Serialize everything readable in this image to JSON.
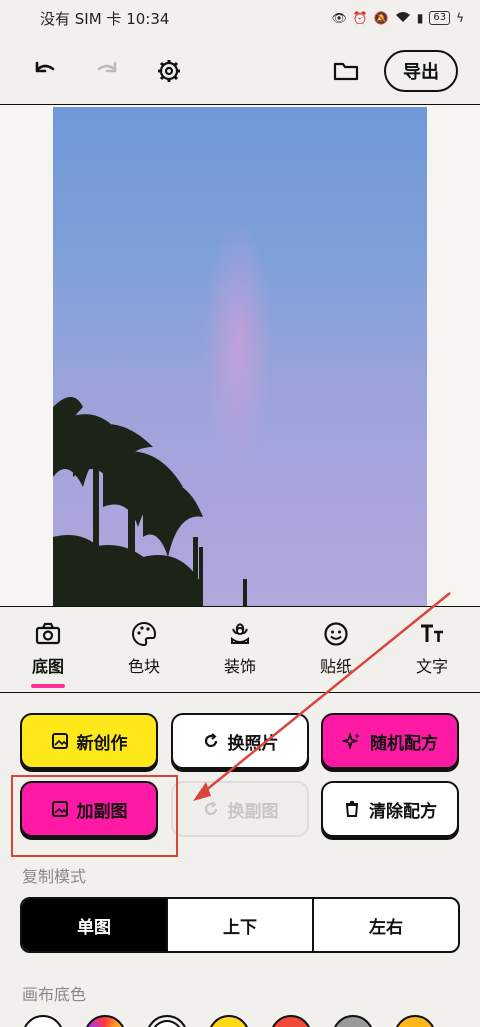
{
  "status_bar": {
    "carrier": "没有 SIM 卡",
    "time": "10:34",
    "battery": "63"
  },
  "toolbar": {
    "export_label": "导出"
  },
  "tabs": [
    {
      "label": "底图",
      "icon": "camera-icon",
      "active": true
    },
    {
      "label": "色块",
      "icon": "palette-icon",
      "active": false
    },
    {
      "label": "装饰",
      "icon": "flower-icon",
      "active": false
    },
    {
      "label": "贴纸",
      "icon": "smiley-icon",
      "active": false
    },
    {
      "label": "文字",
      "icon": "text-size-icon",
      "active": false
    }
  ],
  "actions": {
    "new_creation": "新创作",
    "change_photo": "换照片",
    "random_recipe": "随机配方",
    "add_sub_image": "加副图",
    "change_sub_image": "换副图",
    "clear_recipe": "清除配方"
  },
  "copy_mode": {
    "label": "复制模式",
    "options": [
      "单图",
      "上下",
      "左右"
    ],
    "selected": "单图"
  },
  "canvas_bg": {
    "label": "画布底色",
    "colors": [
      "#ffffff",
      "#5a5ae0",
      "#ffffff",
      "#ffd81a",
      "#f04a3a",
      "#9a9a9a",
      "#ffb81a"
    ]
  },
  "colors": {
    "accent_pink": "#ff1aa5",
    "accent_yellow": "#ffe81a",
    "highlight_red": "#d9453e"
  }
}
